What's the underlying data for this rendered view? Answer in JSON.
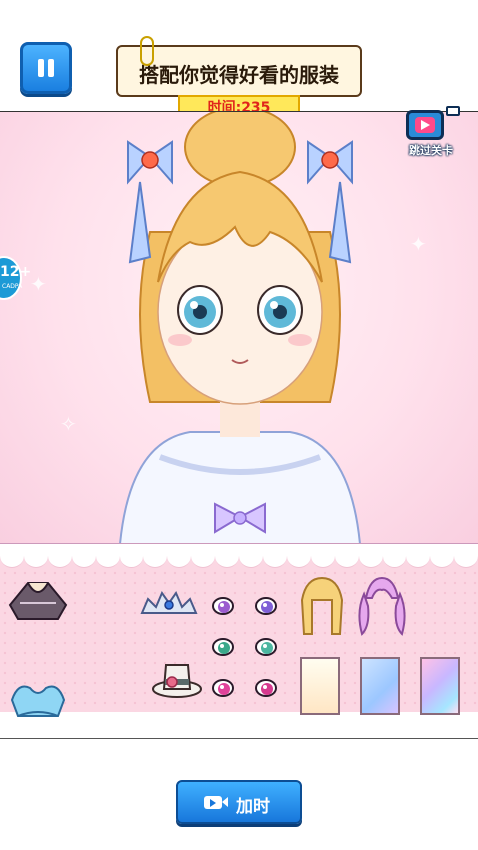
{
  "header": {
    "title": "搭配你觉得好看的服装",
    "timer_label": "时间:",
    "timer_value": "235"
  },
  "skip": {
    "label": "跳过关卡",
    "icon": "tv-play-icon"
  },
  "age_badge": {
    "rating": "12+",
    "org": "CADPA"
  },
  "palette": {
    "accent_blue": "#1a7fe0",
    "panel_pink": "#fbd7e3",
    "timer_red": "#e0251b",
    "timer_yellow": "#ffe85a"
  },
  "wardrobe": {
    "clothes": [
      "bodice",
      "blue-crop-top"
    ],
    "accessories": [
      "tiara",
      "flower-hat"
    ],
    "eye_colors": [
      "#9b5ccf",
      "#7e5fd6",
      "#3aa88a",
      "#4cb6a0",
      "#e0429a",
      "#d63a8f"
    ],
    "hairstyles": [
      "blonde-bob",
      "pink-twintails"
    ],
    "backgrounds": [
      "cream",
      "blue",
      "holographic"
    ]
  },
  "footer": {
    "add_time_label": "加时",
    "add_time_icon": "video-camera-icon"
  }
}
